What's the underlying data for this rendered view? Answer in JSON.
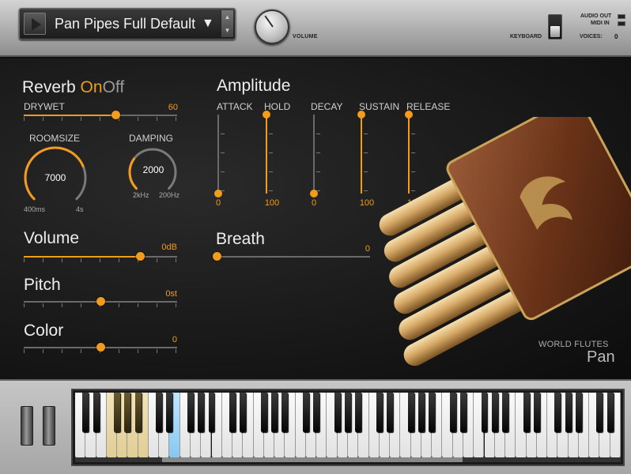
{
  "header": {
    "preset_name": "Pan Pipes Full Default",
    "preset_caret": "▼",
    "stepper_up": "▲",
    "stepper_down": "▼",
    "volume_label": "VOLUME",
    "volume_level": 0.8,
    "keyboard_label": "KEYBOARD",
    "audio_out_label": "AUDIO OUT",
    "midi_in_label": "MIDI IN",
    "voices_label": "VOICES:",
    "voices_value": "0"
  },
  "reverb": {
    "title": "Reverb",
    "on_label": "On",
    "off_label": "Off",
    "drywet_label": "DRYWET",
    "drywet_value": "60",
    "drywet_level": 0.6,
    "roomsize_label": "ROOMSIZE",
    "roomsize_value": "7000",
    "roomsize_level": 0.75,
    "roomsize_min": "400ms",
    "roomsize_max": "4s",
    "damping_label": "DAMPING",
    "damping_value": "2000",
    "damping_level": 0.3,
    "damping_min": "2kHz",
    "damping_max": "200Hz"
  },
  "amplitude": {
    "title": "Amplitude",
    "sliders": [
      {
        "label": "ATTACK",
        "value": "0",
        "level": 0
      },
      {
        "label": "HOLD",
        "value": "100",
        "level": 1
      },
      {
        "label": "DECAY",
        "value": "0",
        "level": 0
      },
      {
        "label": "SUSTAIN",
        "value": "100",
        "level": 1
      },
      {
        "label": "RELEASE",
        "value": "100",
        "level": 1
      }
    ]
  },
  "volume": {
    "title": "Volume",
    "value": "0dB",
    "level": 0.76
  },
  "pitch": {
    "title": "Pitch",
    "value": "0st",
    "level": 0.5
  },
  "color": {
    "title": "Color",
    "value": "0",
    "level": 0.5
  },
  "breath": {
    "title": "Breath",
    "value": "0",
    "level": 0
  },
  "branding": {
    "line1": "WORLD FLUTES",
    "line2": "Pan"
  },
  "colors": {
    "accent": "#f29b1c",
    "highlight_key": "#e8d8a8",
    "pressed_key": "#9cd4f7"
  }
}
